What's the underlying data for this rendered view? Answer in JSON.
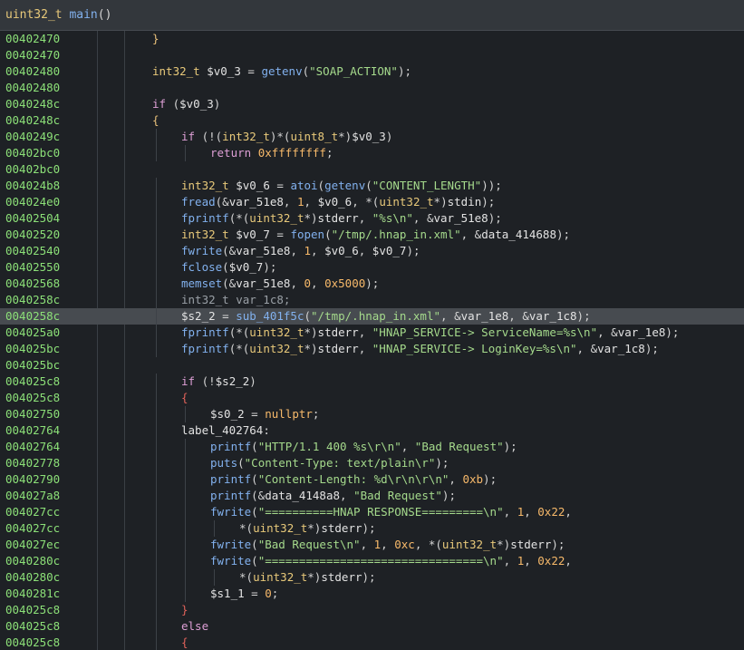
{
  "window": {
    "title_tokens": [
      {
        "t": "uint32_t",
        "c": "type"
      },
      {
        "t": " ",
        "c": "plain"
      },
      {
        "t": "main",
        "c": "func"
      },
      {
        "t": "()",
        "c": "plain"
      }
    ]
  },
  "colors": {
    "background": "#1e2125",
    "titlebar": "#33373c",
    "address": "#8ce078",
    "highlight": "#474b50",
    "keyword": "#dd9fd5",
    "type": "#e8c97a",
    "func": "#82b1ee",
    "string": "#a5da8c",
    "number": "#f7b96a",
    "variable": "#e3e3e3",
    "plain": "#d4d4d4",
    "brace": "#e8c07a",
    "brace_red": "#e0625a",
    "dim": "#9aa0a6"
  },
  "lines": [
    {
      "addr": "00402470",
      "indent": 0,
      "tokens": [
        {
          "t": "}",
          "c": "brace"
        }
      ]
    },
    {
      "addr": "00402470",
      "indent": 0,
      "tokens": []
    },
    {
      "addr": "00402480",
      "indent": 0,
      "tokens": [
        {
          "t": "int32_t",
          "c": "type"
        },
        {
          "t": " ",
          "c": "plain"
        },
        {
          "t": "$v0_3",
          "c": "variable"
        },
        {
          "t": " = ",
          "c": "plain"
        },
        {
          "t": "getenv",
          "c": "func"
        },
        {
          "t": "(",
          "c": "plain"
        },
        {
          "t": "\"SOAP_ACTION\"",
          "c": "string"
        },
        {
          "t": ");",
          "c": "plain"
        }
      ]
    },
    {
      "addr": "00402480",
      "indent": 0,
      "tokens": []
    },
    {
      "addr": "0040248c",
      "indent": 0,
      "tokens": [
        {
          "t": "if",
          "c": "keyword"
        },
        {
          "t": " (",
          "c": "plain"
        },
        {
          "t": "$v0_3",
          "c": "variable"
        },
        {
          "t": ")",
          "c": "plain"
        }
      ]
    },
    {
      "addr": "0040248c",
      "indent": 0,
      "tokens": [
        {
          "t": "{",
          "c": "brace"
        }
      ]
    },
    {
      "addr": "0040249c",
      "indent": 1,
      "tokens": [
        {
          "t": "if",
          "c": "keyword"
        },
        {
          "t": " (!(",
          "c": "plain"
        },
        {
          "t": "int32_t",
          "c": "type"
        },
        {
          "t": ")*(",
          "c": "plain"
        },
        {
          "t": "uint8_t",
          "c": "type"
        },
        {
          "t": "*)",
          "c": "plain"
        },
        {
          "t": "$v0_3",
          "c": "variable"
        },
        {
          "t": ")",
          "c": "plain"
        }
      ]
    },
    {
      "addr": "00402bc0",
      "indent": 2,
      "tokens": [
        {
          "t": "return",
          "c": "keyword"
        },
        {
          "t": " ",
          "c": "plain"
        },
        {
          "t": "0xffffffff",
          "c": "number"
        },
        {
          "t": ";",
          "c": "plain"
        }
      ]
    },
    {
      "addr": "00402bc0",
      "indent": 0,
      "tokens": []
    },
    {
      "addr": "004024b8",
      "indent": 1,
      "tokens": [
        {
          "t": "int32_t",
          "c": "type"
        },
        {
          "t": " ",
          "c": "plain"
        },
        {
          "t": "$v0_6",
          "c": "variable"
        },
        {
          "t": " = ",
          "c": "plain"
        },
        {
          "t": "atoi",
          "c": "func"
        },
        {
          "t": "(",
          "c": "plain"
        },
        {
          "t": "getenv",
          "c": "func"
        },
        {
          "t": "(",
          "c": "plain"
        },
        {
          "t": "\"CONTENT_LENGTH\"",
          "c": "string"
        },
        {
          "t": "));",
          "c": "plain"
        }
      ]
    },
    {
      "addr": "004024e0",
      "indent": 1,
      "tokens": [
        {
          "t": "fread",
          "c": "func"
        },
        {
          "t": "(&",
          "c": "plain"
        },
        {
          "t": "var_51e8",
          "c": "variable"
        },
        {
          "t": ", ",
          "c": "plain"
        },
        {
          "t": "1",
          "c": "number"
        },
        {
          "t": ", ",
          "c": "plain"
        },
        {
          "t": "$v0_6",
          "c": "variable"
        },
        {
          "t": ", *(",
          "c": "plain"
        },
        {
          "t": "uint32_t",
          "c": "type"
        },
        {
          "t": "*)",
          "c": "plain"
        },
        {
          "t": "stdin",
          "c": "variable"
        },
        {
          "t": ");",
          "c": "plain"
        }
      ]
    },
    {
      "addr": "00402504",
      "indent": 1,
      "tokens": [
        {
          "t": "fprintf",
          "c": "func"
        },
        {
          "t": "(*(",
          "c": "plain"
        },
        {
          "t": "uint32_t",
          "c": "type"
        },
        {
          "t": "*)",
          "c": "plain"
        },
        {
          "t": "stderr",
          "c": "variable"
        },
        {
          "t": ", ",
          "c": "plain"
        },
        {
          "t": "\"%s\\n\"",
          "c": "string"
        },
        {
          "t": ", &",
          "c": "plain"
        },
        {
          "t": "var_51e8",
          "c": "variable"
        },
        {
          "t": ");",
          "c": "plain"
        }
      ]
    },
    {
      "addr": "00402520",
      "indent": 1,
      "tokens": [
        {
          "t": "int32_t",
          "c": "type"
        },
        {
          "t": " ",
          "c": "plain"
        },
        {
          "t": "$v0_7",
          "c": "variable"
        },
        {
          "t": " = ",
          "c": "plain"
        },
        {
          "t": "fopen",
          "c": "func"
        },
        {
          "t": "(",
          "c": "plain"
        },
        {
          "t": "\"/tmp/.hnap_in.xml\"",
          "c": "string"
        },
        {
          "t": ", &",
          "c": "plain"
        },
        {
          "t": "data_414688",
          "c": "variable"
        },
        {
          "t": ");",
          "c": "plain"
        }
      ]
    },
    {
      "addr": "00402540",
      "indent": 1,
      "tokens": [
        {
          "t": "fwrite",
          "c": "func"
        },
        {
          "t": "(&",
          "c": "plain"
        },
        {
          "t": "var_51e8",
          "c": "variable"
        },
        {
          "t": ", ",
          "c": "plain"
        },
        {
          "t": "1",
          "c": "number"
        },
        {
          "t": ", ",
          "c": "plain"
        },
        {
          "t": "$v0_6",
          "c": "variable"
        },
        {
          "t": ", ",
          "c": "plain"
        },
        {
          "t": "$v0_7",
          "c": "variable"
        },
        {
          "t": ");",
          "c": "plain"
        }
      ]
    },
    {
      "addr": "00402550",
      "indent": 1,
      "tokens": [
        {
          "t": "fclose",
          "c": "func"
        },
        {
          "t": "(",
          "c": "plain"
        },
        {
          "t": "$v0_7",
          "c": "variable"
        },
        {
          "t": ");",
          "c": "plain"
        }
      ]
    },
    {
      "addr": "00402568",
      "indent": 1,
      "tokens": [
        {
          "t": "memset",
          "c": "func"
        },
        {
          "t": "(&",
          "c": "plain"
        },
        {
          "t": "var_51e8",
          "c": "variable"
        },
        {
          "t": ", ",
          "c": "plain"
        },
        {
          "t": "0",
          "c": "number"
        },
        {
          "t": ", ",
          "c": "plain"
        },
        {
          "t": "0x5000",
          "c": "number"
        },
        {
          "t": ");",
          "c": "plain"
        }
      ]
    },
    {
      "addr": "0040258c",
      "indent": 1,
      "tokens": [
        {
          "t": "int32_t var_1c8;",
          "c": "dim"
        }
      ]
    },
    {
      "addr": "0040258c",
      "indent": 1,
      "highlight": true,
      "tokens": [
        {
          "t": "$s2_2",
          "c": "variable"
        },
        {
          "t": " = ",
          "c": "plain"
        },
        {
          "t": "sub_401f5c",
          "c": "func"
        },
        {
          "t": "(",
          "c": "plain"
        },
        {
          "t": "\"/tmp/.hnap_in.xml\"",
          "c": "string"
        },
        {
          "t": ", &",
          "c": "plain"
        },
        {
          "t": "var_1e8",
          "c": "variable"
        },
        {
          "t": ", &",
          "c": "plain"
        },
        {
          "t": "var_1c8",
          "c": "variable"
        },
        {
          "t": ");",
          "c": "plain"
        }
      ]
    },
    {
      "addr": "004025a0",
      "indent": 1,
      "tokens": [
        {
          "t": "fprintf",
          "c": "func"
        },
        {
          "t": "(*(",
          "c": "plain"
        },
        {
          "t": "uint32_t",
          "c": "type"
        },
        {
          "t": "*)",
          "c": "plain"
        },
        {
          "t": "stderr",
          "c": "variable"
        },
        {
          "t": ", ",
          "c": "plain"
        },
        {
          "t": "\"HNAP_SERVICE-> ServiceName=%s\\n\"",
          "c": "string"
        },
        {
          "t": ", &",
          "c": "plain"
        },
        {
          "t": "var_1e8",
          "c": "variable"
        },
        {
          "t": ");",
          "c": "plain"
        }
      ]
    },
    {
      "addr": "004025bc",
      "indent": 1,
      "tokens": [
        {
          "t": "fprintf",
          "c": "func"
        },
        {
          "t": "(*(",
          "c": "plain"
        },
        {
          "t": "uint32_t",
          "c": "type"
        },
        {
          "t": "*)",
          "c": "plain"
        },
        {
          "t": "stderr",
          "c": "variable"
        },
        {
          "t": ", ",
          "c": "plain"
        },
        {
          "t": "\"HNAP_SERVICE-> LoginKey=%s\\n\"",
          "c": "string"
        },
        {
          "t": ", &",
          "c": "plain"
        },
        {
          "t": "var_1c8",
          "c": "variable"
        },
        {
          "t": ");",
          "c": "plain"
        }
      ]
    },
    {
      "addr": "004025bc",
      "indent": 0,
      "tokens": []
    },
    {
      "addr": "004025c8",
      "indent": 1,
      "tokens": [
        {
          "t": "if",
          "c": "keyword"
        },
        {
          "t": " (!",
          "c": "plain"
        },
        {
          "t": "$s2_2",
          "c": "variable"
        },
        {
          "t": ")",
          "c": "plain"
        }
      ]
    },
    {
      "addr": "004025c8",
      "indent": 1,
      "tokens": [
        {
          "t": "{",
          "c": "brace_red"
        }
      ]
    },
    {
      "addr": "00402750",
      "indent": 2,
      "tokens": [
        {
          "t": "$s0_2",
          "c": "variable"
        },
        {
          "t": " = ",
          "c": "plain"
        },
        {
          "t": "nullptr",
          "c": "number"
        },
        {
          "t": ";",
          "c": "plain"
        }
      ]
    },
    {
      "addr": "00402764",
      "indent": 1,
      "tokens": [
        {
          "t": "label_402764",
          "c": "variable"
        },
        {
          "t": ":",
          "c": "plain"
        }
      ]
    },
    {
      "addr": "00402764",
      "indent": 2,
      "tokens": [
        {
          "t": "printf",
          "c": "func"
        },
        {
          "t": "(",
          "c": "plain"
        },
        {
          "t": "\"HTTP/1.1 400 %s\\r\\n\"",
          "c": "string"
        },
        {
          "t": ", ",
          "c": "plain"
        },
        {
          "t": "\"Bad Request\"",
          "c": "string"
        },
        {
          "t": ");",
          "c": "plain"
        }
      ]
    },
    {
      "addr": "00402778",
      "indent": 2,
      "tokens": [
        {
          "t": "puts",
          "c": "func"
        },
        {
          "t": "(",
          "c": "plain"
        },
        {
          "t": "\"Content-Type: text/plain\\r\"",
          "c": "string"
        },
        {
          "t": ");",
          "c": "plain"
        }
      ]
    },
    {
      "addr": "00402790",
      "indent": 2,
      "tokens": [
        {
          "t": "printf",
          "c": "func"
        },
        {
          "t": "(",
          "c": "plain"
        },
        {
          "t": "\"Content-Length: %d\\r\\n\\r\\n\"",
          "c": "string"
        },
        {
          "t": ", ",
          "c": "plain"
        },
        {
          "t": "0xb",
          "c": "number"
        },
        {
          "t": ");",
          "c": "plain"
        }
      ]
    },
    {
      "addr": "004027a8",
      "indent": 2,
      "tokens": [
        {
          "t": "printf",
          "c": "func"
        },
        {
          "t": "(&",
          "c": "plain"
        },
        {
          "t": "data_4148a8",
          "c": "variable"
        },
        {
          "t": ", ",
          "c": "plain"
        },
        {
          "t": "\"Bad Request\"",
          "c": "string"
        },
        {
          "t": ");",
          "c": "plain"
        }
      ]
    },
    {
      "addr": "004027cc",
      "indent": 2,
      "tokens": [
        {
          "t": "fwrite",
          "c": "func"
        },
        {
          "t": "(",
          "c": "plain"
        },
        {
          "t": "\"==========HNAP RESPONSE=========\\n\"",
          "c": "string"
        },
        {
          "t": ", ",
          "c": "plain"
        },
        {
          "t": "1",
          "c": "number"
        },
        {
          "t": ", ",
          "c": "plain"
        },
        {
          "t": "0x22",
          "c": "number"
        },
        {
          "t": ",",
          "c": "plain"
        }
      ]
    },
    {
      "addr": "004027cc",
      "indent": 3,
      "tokens": [
        {
          "t": "*(",
          "c": "plain"
        },
        {
          "t": "uint32_t",
          "c": "type"
        },
        {
          "t": "*)",
          "c": "plain"
        },
        {
          "t": "stderr",
          "c": "variable"
        },
        {
          "t": ");",
          "c": "plain"
        }
      ]
    },
    {
      "addr": "004027ec",
      "indent": 2,
      "tokens": [
        {
          "t": "fwrite",
          "c": "func"
        },
        {
          "t": "(",
          "c": "plain"
        },
        {
          "t": "\"Bad Request\\n\"",
          "c": "string"
        },
        {
          "t": ", ",
          "c": "plain"
        },
        {
          "t": "1",
          "c": "number"
        },
        {
          "t": ", ",
          "c": "plain"
        },
        {
          "t": "0xc",
          "c": "number"
        },
        {
          "t": ", *(",
          "c": "plain"
        },
        {
          "t": "uint32_t",
          "c": "type"
        },
        {
          "t": "*)",
          "c": "plain"
        },
        {
          "t": "stderr",
          "c": "variable"
        },
        {
          "t": ");",
          "c": "plain"
        }
      ]
    },
    {
      "addr": "0040280c",
      "indent": 2,
      "tokens": [
        {
          "t": "fwrite",
          "c": "func"
        },
        {
          "t": "(",
          "c": "plain"
        },
        {
          "t": "\"================================\\n\"",
          "c": "string"
        },
        {
          "t": ", ",
          "c": "plain"
        },
        {
          "t": "1",
          "c": "number"
        },
        {
          "t": ", ",
          "c": "plain"
        },
        {
          "t": "0x22",
          "c": "number"
        },
        {
          "t": ",",
          "c": "plain"
        }
      ]
    },
    {
      "addr": "0040280c",
      "indent": 3,
      "tokens": [
        {
          "t": "*(",
          "c": "plain"
        },
        {
          "t": "uint32_t",
          "c": "type"
        },
        {
          "t": "*)",
          "c": "plain"
        },
        {
          "t": "stderr",
          "c": "variable"
        },
        {
          "t": ");",
          "c": "plain"
        }
      ]
    },
    {
      "addr": "0040281c",
      "indent": 2,
      "tokens": [
        {
          "t": "$s1_1",
          "c": "variable"
        },
        {
          "t": " = ",
          "c": "plain"
        },
        {
          "t": "0",
          "c": "number"
        },
        {
          "t": ";",
          "c": "plain"
        }
      ]
    },
    {
      "addr": "004025c8",
      "indent": 1,
      "tokens": [
        {
          "t": "}",
          "c": "brace_red"
        }
      ]
    },
    {
      "addr": "004025c8",
      "indent": 1,
      "tokens": [
        {
          "t": "else",
          "c": "keyword"
        }
      ]
    },
    {
      "addr": "004025c8",
      "indent": 1,
      "tokens": [
        {
          "t": "{",
          "c": "brace_red"
        }
      ]
    }
  ]
}
